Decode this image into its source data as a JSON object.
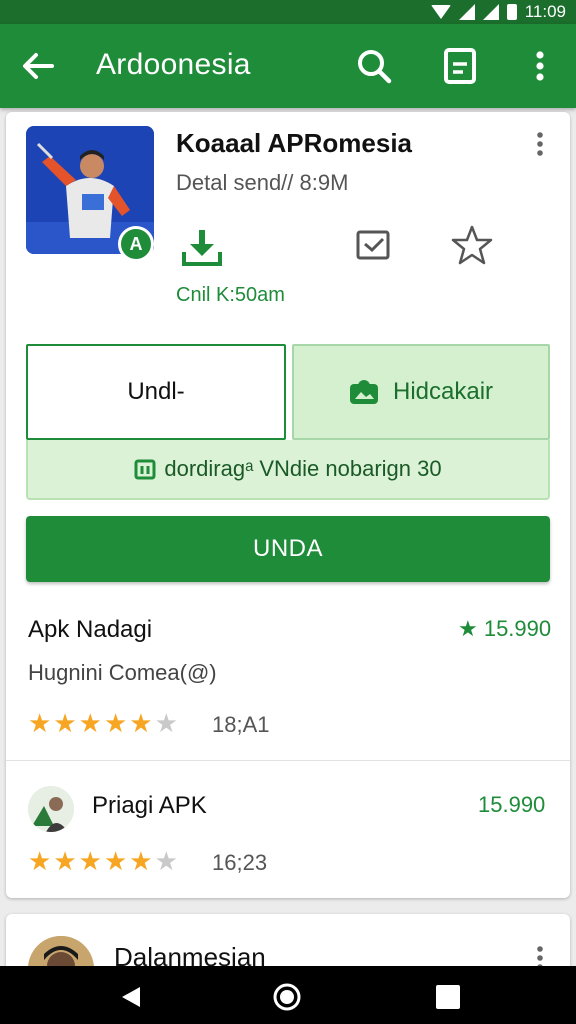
{
  "status_bar": {
    "time": "11:09"
  },
  "app_bar": {
    "title": "Ardoonesia"
  },
  "app": {
    "title": "Koaaal APRomesia",
    "subtitle": "Detal send// 8:9M",
    "meta": "Cnil K:50am",
    "badge": "A"
  },
  "buttons": {
    "outline_label": "Undl-",
    "secondary_label": "Hidcakair",
    "primary_label": "UNDA"
  },
  "promo": {
    "text": "dordiragᵃ VNdie nobarign 30"
  },
  "reviews": [
    {
      "title": "Apk Nadagi",
      "price": "★ 15.990",
      "subtitle": "Hugnini Comea(@)",
      "rating": 4.5,
      "count": "18;A1"
    },
    {
      "title": "Priagi APK",
      "price": "15.990",
      "rating": 4.5,
      "count": "16;23"
    }
  ],
  "next_card": {
    "name": "Dalanmesian"
  },
  "icons": {
    "back": "arrow-back-icon",
    "search": "search-icon",
    "doc": "document-icon",
    "more": "more-vert-icon",
    "download": "download-icon",
    "message": "message-icon",
    "star": "star-outline-icon"
  },
  "colors": {
    "primary": "#1f8c3a",
    "statusbar": "#1b6e2c",
    "light": "#d4f0cf",
    "star": "#f6a623"
  }
}
